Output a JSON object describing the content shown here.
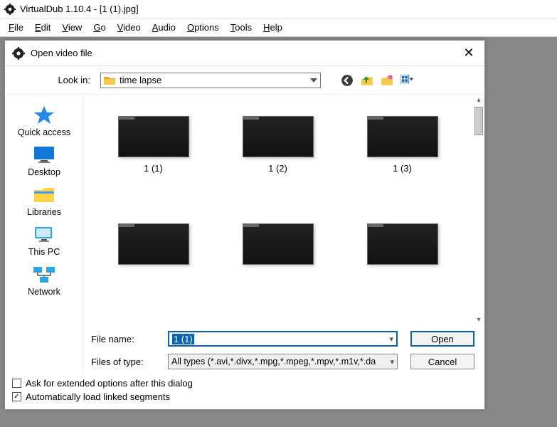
{
  "titlebar": {
    "text": "VirtualDub 1.10.4 - [1 (1).jpg]"
  },
  "menubar": {
    "items": [
      {
        "accel": "F",
        "rest": "ile"
      },
      {
        "accel": "E",
        "rest": "dit"
      },
      {
        "accel": "V",
        "rest": "iew"
      },
      {
        "accel": "G",
        "rest": "o"
      },
      {
        "accel": "V",
        "rest": "ideo"
      },
      {
        "accel": "A",
        "rest": "udio"
      },
      {
        "accel": "O",
        "rest": "ptions"
      },
      {
        "accel": "T",
        "rest": "ools"
      },
      {
        "accel": "H",
        "rest": "elp"
      }
    ]
  },
  "dialog": {
    "title": "Open video file",
    "lookin_label": "Look in:",
    "lookin_value": "time lapse",
    "sidebar": {
      "items": [
        {
          "label": "Quick access"
        },
        {
          "label": "Desktop"
        },
        {
          "label": "Libraries"
        },
        {
          "label": "This PC"
        },
        {
          "label": "Network"
        }
      ]
    },
    "files": [
      {
        "label": "1 (1)"
      },
      {
        "label": "1 (2)"
      },
      {
        "label": "1 (3)"
      },
      {
        "label": ""
      },
      {
        "label": ""
      },
      {
        "label": ""
      }
    ],
    "fields": {
      "filename_label": "File name:",
      "filename_value": "1 (1)",
      "filetype_label": "Files of type:",
      "filetype_value": "All types (*.avi,*.divx,*.mpg,*.mpeg,*.mpv,*.m1v,*.da"
    },
    "buttons": {
      "open": "Open",
      "cancel": "Cancel"
    },
    "options": {
      "extended": {
        "checked": false,
        "label": "Ask for extended options after this dialog"
      },
      "autoload": {
        "checked": true,
        "label": "Automatically load linked segments"
      }
    }
  }
}
